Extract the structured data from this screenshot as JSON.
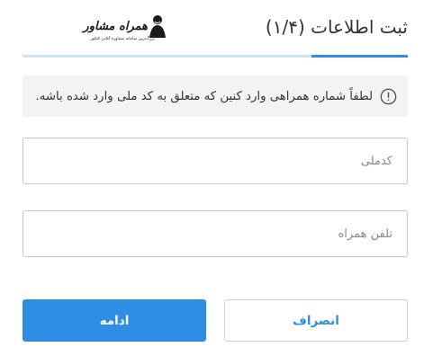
{
  "header": {
    "title": "ثبت اطلاعات (۱/۴)",
    "logo_text": "همراه مشاور",
    "logo_subtitle": "بزرگ‌ترین سامانه مشاوره آنلاین کنکور"
  },
  "progress": {
    "current_step": 1,
    "total_steps": 4,
    "fraction": 0.25,
    "fill_color": "#2f8de4",
    "track_color": "#cfe3f5"
  },
  "notice": {
    "icon": "info-circle-icon",
    "text": "لطفاً شماره همراهی وارد کنین که متعلق به کد ملی وارد شده باشه."
  },
  "form": {
    "national_id": {
      "placeholder": "کدملی",
      "value": ""
    },
    "phone": {
      "placeholder": "تلفن همراه",
      "value": ""
    }
  },
  "buttons": {
    "continue_label": "ادامه",
    "cancel_label": "انصراف"
  },
  "colors": {
    "accent": "#2f8de4",
    "notice_bg": "#f2f3f5",
    "border": "#c9c9c9"
  }
}
